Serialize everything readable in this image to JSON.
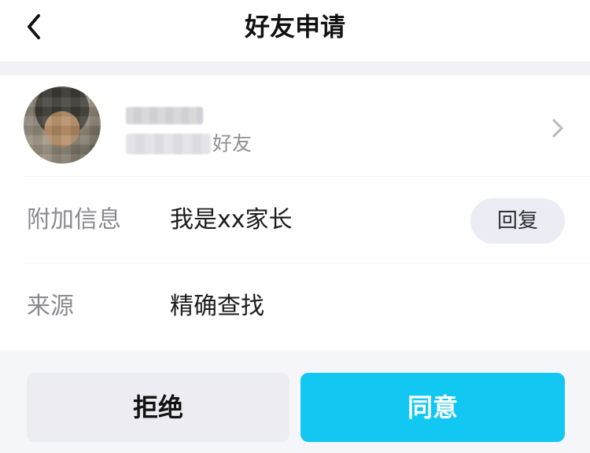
{
  "header": {
    "title": "好友申请",
    "back_icon": "chevron-left-icon"
  },
  "profile": {
    "name": "",
    "subtitle_suffix": "好友",
    "chevron_icon": "chevron-right-icon"
  },
  "rows": {
    "additional_info": {
      "label": "附加信息",
      "value": "我是xx家长",
      "reply_label": "回复"
    },
    "source": {
      "label": "来源",
      "value": "精确查找"
    }
  },
  "actions": {
    "reject_label": "拒绝",
    "accept_label": "同意"
  },
  "colors": {
    "accent": "#12c7f1",
    "page_background": "#f1f1f6"
  }
}
